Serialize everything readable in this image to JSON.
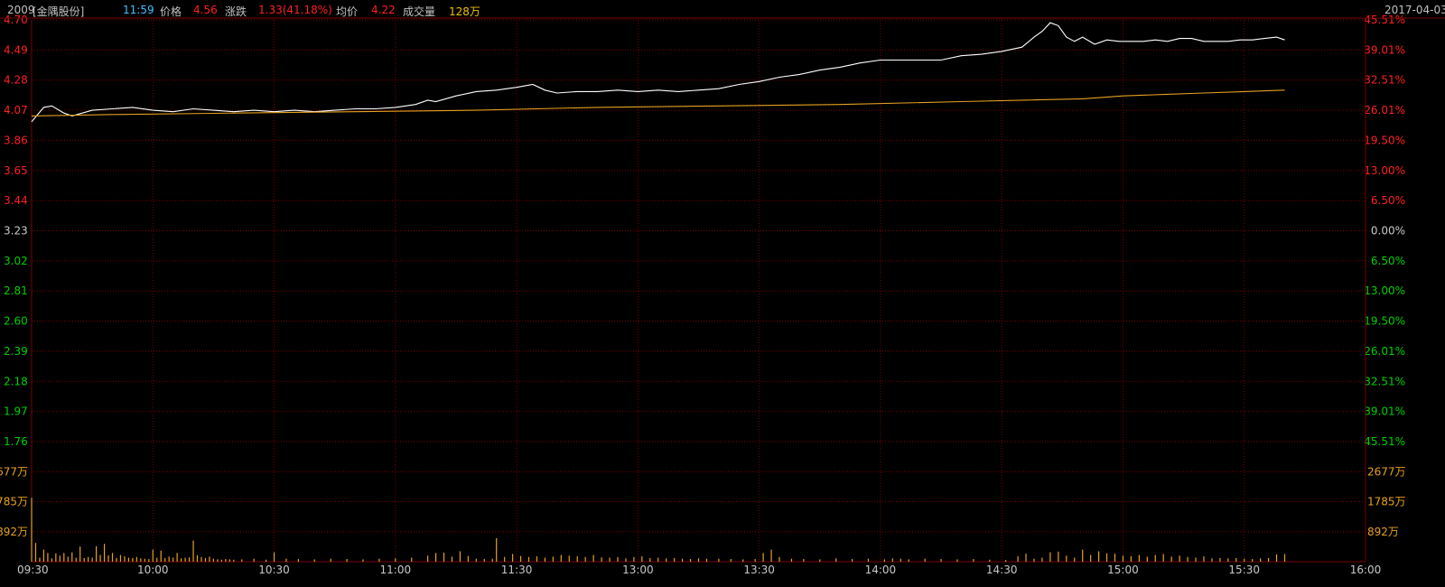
{
  "header": {
    "code": "2009",
    "name": "[金隅股份]",
    "time": "11:59",
    "price_label": "价格",
    "price": "4.56",
    "change_label": "涨跌",
    "change": "1.33(41.18%)",
    "avg_label": "均价",
    "avg": "4.22",
    "volume_label": "成交量",
    "volume": "128万",
    "date": "2017-04-03"
  },
  "colors": {
    "background": "#000000",
    "grid": "#7a0000",
    "up": "#ff2020",
    "down": "#00d000",
    "neutral": "#c8c8c8",
    "price_line": "#ffffff",
    "avg_line": "#e6a020",
    "volume": "#e6a020",
    "code": "#c0c0c0",
    "time": "#40c0ff"
  },
  "chart_data": {
    "type": "line",
    "x": [
      "09:30",
      "10:00",
      "10:30",
      "11:00",
      "11:30",
      "13:00",
      "13:30",
      "14:00",
      "14:30",
      "15:00",
      "15:30",
      "16:00"
    ],
    "price_ticks": [
      "4.70",
      "4.49",
      "4.28",
      "4.07",
      "3.86",
      "3.65",
      "3.44",
      "3.23",
      "3.02",
      "2.81",
      "2.60",
      "2.39",
      "2.18",
      "1.97",
      "1.76"
    ],
    "pct_ticks": [
      "45.51%",
      "39.01%",
      "32.51%",
      "26.01%",
      "19.50%",
      "13.00%",
      "6.50%",
      "0.00%",
      "6.50%",
      "13.00%",
      "19.50%",
      "26.01%",
      "32.51%",
      "39.01%",
      "45.51%"
    ],
    "volume_ticks": [
      "2677万",
      "1785万",
      "892万"
    ],
    "ylim": [
      1.76,
      4.7
    ],
    "prev_close": 3.23,
    "volume_max": 3570,
    "series": [
      {
        "values": [
          [
            0,
            3.99
          ],
          [
            3,
            4.09
          ],
          [
            5,
            4.1
          ],
          [
            8,
            4.05
          ],
          [
            10,
            4.03
          ],
          [
            15,
            4.07
          ],
          [
            20,
            4.08
          ],
          [
            25,
            4.09
          ],
          [
            30,
            4.07
          ],
          [
            35,
            4.06
          ],
          [
            40,
            4.08
          ],
          [
            45,
            4.07
          ],
          [
            50,
            4.06
          ],
          [
            55,
            4.07
          ],
          [
            60,
            4.06
          ],
          [
            65,
            4.07
          ],
          [
            70,
            4.06
          ],
          [
            75,
            4.07
          ],
          [
            80,
            4.08
          ],
          [
            85,
            4.08
          ],
          [
            90,
            4.09
          ],
          [
            95,
            4.11
          ],
          [
            98,
            4.14
          ],
          [
            100,
            4.13
          ],
          [
            105,
            4.17
          ],
          [
            110,
            4.2
          ],
          [
            115,
            4.21
          ],
          [
            120,
            4.23
          ],
          [
            124,
            4.25
          ],
          [
            127,
            4.21
          ],
          [
            130,
            4.19
          ],
          [
            135,
            4.2
          ],
          [
            140,
            4.2
          ],
          [
            145,
            4.21
          ],
          [
            150,
            4.2
          ],
          [
            155,
            4.21
          ],
          [
            160,
            4.2
          ],
          [
            165,
            4.21
          ],
          [
            170,
            4.22
          ],
          [
            175,
            4.25
          ],
          [
            180,
            4.27
          ],
          [
            185,
            4.3
          ],
          [
            190,
            4.32
          ],
          [
            195,
            4.35
          ],
          [
            200,
            4.37
          ],
          [
            205,
            4.4
          ],
          [
            210,
            4.42
          ],
          [
            215,
            4.42
          ],
          [
            220,
            4.42
          ],
          [
            225,
            4.42
          ],
          [
            230,
            4.45
          ],
          [
            235,
            4.46
          ],
          [
            240,
            4.48
          ],
          [
            245,
            4.51
          ],
          [
            248,
            4.58
          ],
          [
            250,
            4.62
          ],
          [
            252,
            4.68
          ],
          [
            254,
            4.66
          ],
          [
            256,
            4.58
          ],
          [
            258,
            4.55
          ],
          [
            260,
            4.58
          ],
          [
            263,
            4.53
          ],
          [
            266,
            4.56
          ],
          [
            269,
            4.55
          ],
          [
            272,
            4.55
          ],
          [
            275,
            4.55
          ],
          [
            278,
            4.56
          ],
          [
            281,
            4.55
          ],
          [
            284,
            4.57
          ],
          [
            287,
            4.57
          ],
          [
            290,
            4.55
          ],
          [
            293,
            4.55
          ],
          [
            296,
            4.55
          ],
          [
            299,
            4.56
          ],
          [
            302,
            4.56
          ],
          [
            305,
            4.57
          ],
          [
            308,
            4.58
          ],
          [
            310,
            4.56
          ]
        ]
      },
      {
        "values": [
          [
            0,
            4.03
          ],
          [
            20,
            4.04
          ],
          [
            50,
            4.05
          ],
          [
            80,
            4.06
          ],
          [
            110,
            4.07
          ],
          [
            140,
            4.09
          ],
          [
            170,
            4.1
          ],
          [
            200,
            4.11
          ],
          [
            230,
            4.13
          ],
          [
            260,
            4.15
          ],
          [
            270,
            4.17
          ],
          [
            280,
            4.18
          ],
          [
            290,
            4.19
          ],
          [
            300,
            4.2
          ],
          [
            310,
            4.21
          ]
        ]
      }
    ],
    "volume": [
      [
        0,
        1900
      ],
      [
        1,
        560
      ],
      [
        2,
        120
      ],
      [
        3,
        360
      ],
      [
        4,
        260
      ],
      [
        5,
        100
      ],
      [
        6,
        250
      ],
      [
        7,
        180
      ],
      [
        8,
        260
      ],
      [
        9,
        150
      ],
      [
        10,
        280
      ],
      [
        11,
        120
      ],
      [
        12,
        450
      ],
      [
        13,
        110
      ],
      [
        14,
        140
      ],
      [
        15,
        120
      ],
      [
        16,
        460
      ],
      [
        17,
        200
      ],
      [
        18,
        530
      ],
      [
        19,
        190
      ],
      [
        20,
        260
      ],
      [
        21,
        110
      ],
      [
        22,
        200
      ],
      [
        23,
        160
      ],
      [
        24,
        120
      ],
      [
        25,
        110
      ],
      [
        26,
        140
      ],
      [
        27,
        100
      ],
      [
        28,
        90
      ],
      [
        29,
        80
      ],
      [
        30,
        360
      ],
      [
        31,
        120
      ],
      [
        32,
        330
      ],
      [
        33,
        110
      ],
      [
        34,
        150
      ],
      [
        35,
        120
      ],
      [
        36,
        260
      ],
      [
        37,
        100
      ],
      [
        38,
        120
      ],
      [
        39,
        130
      ],
      [
        40,
        630
      ],
      [
        41,
        190
      ],
      [
        42,
        140
      ],
      [
        43,
        110
      ],
      [
        44,
        150
      ],
      [
        45,
        90
      ],
      [
        46,
        70
      ],
      [
        47,
        60
      ],
      [
        48,
        80
      ],
      [
        49,
        70
      ],
      [
        50,
        60
      ],
      [
        52,
        70
      ],
      [
        55,
        90
      ],
      [
        58,
        60
      ],
      [
        60,
        280
      ],
      [
        63,
        90
      ],
      [
        66,
        80
      ],
      [
        70,
        70
      ],
      [
        74,
        90
      ],
      [
        78,
        80
      ],
      [
        82,
        70
      ],
      [
        86,
        90
      ],
      [
        90,
        100
      ],
      [
        94,
        120
      ],
      [
        98,
        180
      ],
      [
        100,
        260
      ],
      [
        102,
        270
      ],
      [
        104,
        150
      ],
      [
        106,
        310
      ],
      [
        108,
        170
      ],
      [
        110,
        90
      ],
      [
        112,
        80
      ],
      [
        114,
        90
      ],
      [
        115,
        700
      ],
      [
        117,
        140
      ],
      [
        119,
        230
      ],
      [
        121,
        170
      ],
      [
        123,
        140
      ],
      [
        125,
        160
      ],
      [
        127,
        120
      ],
      [
        129,
        150
      ],
      [
        131,
        200
      ],
      [
        133,
        180
      ],
      [
        135,
        160
      ],
      [
        137,
        140
      ],
      [
        139,
        200
      ],
      [
        141,
        130
      ],
      [
        143,
        120
      ],
      [
        145,
        140
      ],
      [
        147,
        100
      ],
      [
        149,
        140
      ],
      [
        151,
        160
      ],
      [
        153,
        110
      ],
      [
        155,
        120
      ],
      [
        157,
        100
      ],
      [
        159,
        110
      ],
      [
        161,
        90
      ],
      [
        163,
        80
      ],
      [
        165,
        100
      ],
      [
        167,
        90
      ],
      [
        170,
        90
      ],
      [
        173,
        80
      ],
      [
        176,
        70
      ],
      [
        179,
        80
      ],
      [
        181,
        260
      ],
      [
        183,
        360
      ],
      [
        185,
        140
      ],
      [
        188,
        90
      ],
      [
        191,
        80
      ],
      [
        195,
        70
      ],
      [
        199,
        100
      ],
      [
        203,
        80
      ],
      [
        207,
        90
      ],
      [
        211,
        70
      ],
      [
        213,
        100
      ],
      [
        215,
        90
      ],
      [
        217,
        70
      ],
      [
        221,
        90
      ],
      [
        225,
        80
      ],
      [
        229,
        70
      ],
      [
        233,
        80
      ],
      [
        237,
        60
      ],
      [
        241,
        50
      ],
      [
        244,
        160
      ],
      [
        246,
        240
      ],
      [
        248,
        90
      ],
      [
        250,
        120
      ],
      [
        252,
        280
      ],
      [
        254,
        300
      ],
      [
        256,
        180
      ],
      [
        258,
        120
      ],
      [
        260,
        360
      ],
      [
        262,
        200
      ],
      [
        264,
        310
      ],
      [
        266,
        250
      ],
      [
        268,
        240
      ],
      [
        270,
        180
      ],
      [
        272,
        160
      ],
      [
        274,
        200
      ],
      [
        276,
        150
      ],
      [
        278,
        200
      ],
      [
        280,
        230
      ],
      [
        282,
        150
      ],
      [
        284,
        180
      ],
      [
        286,
        140
      ],
      [
        288,
        120
      ],
      [
        290,
        160
      ],
      [
        292,
        100
      ],
      [
        294,
        110
      ],
      [
        296,
        100
      ],
      [
        298,
        110
      ],
      [
        300,
        90
      ],
      [
        302,
        80
      ],
      [
        304,
        100
      ],
      [
        306,
        110
      ],
      [
        308,
        220
      ],
      [
        310,
        230
      ]
    ]
  }
}
